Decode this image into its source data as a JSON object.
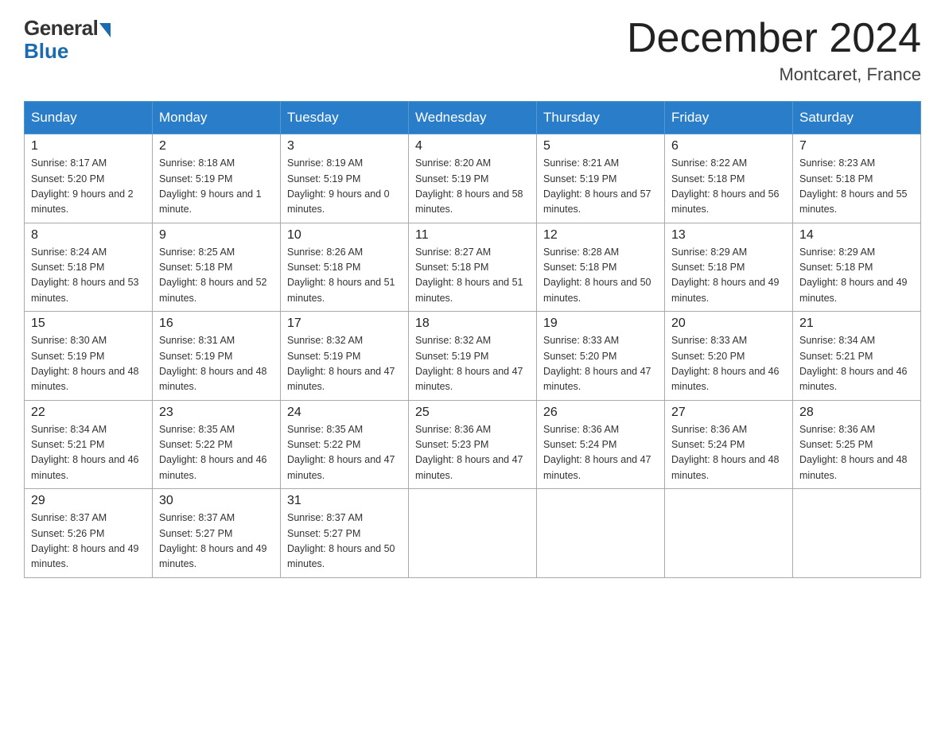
{
  "logo": {
    "general": "General",
    "blue": "Blue"
  },
  "header": {
    "month": "December 2024",
    "location": "Montcaret, France"
  },
  "weekdays": [
    "Sunday",
    "Monday",
    "Tuesday",
    "Wednesday",
    "Thursday",
    "Friday",
    "Saturday"
  ],
  "weeks": [
    [
      {
        "day": "1",
        "sunrise": "8:17 AM",
        "sunset": "5:20 PM",
        "daylight": "9 hours and 2 minutes."
      },
      {
        "day": "2",
        "sunrise": "8:18 AM",
        "sunset": "5:19 PM",
        "daylight": "9 hours and 1 minute."
      },
      {
        "day": "3",
        "sunrise": "8:19 AM",
        "sunset": "5:19 PM",
        "daylight": "9 hours and 0 minutes."
      },
      {
        "day": "4",
        "sunrise": "8:20 AM",
        "sunset": "5:19 PM",
        "daylight": "8 hours and 58 minutes."
      },
      {
        "day": "5",
        "sunrise": "8:21 AM",
        "sunset": "5:19 PM",
        "daylight": "8 hours and 57 minutes."
      },
      {
        "day": "6",
        "sunrise": "8:22 AM",
        "sunset": "5:18 PM",
        "daylight": "8 hours and 56 minutes."
      },
      {
        "day": "7",
        "sunrise": "8:23 AM",
        "sunset": "5:18 PM",
        "daylight": "8 hours and 55 minutes."
      }
    ],
    [
      {
        "day": "8",
        "sunrise": "8:24 AM",
        "sunset": "5:18 PM",
        "daylight": "8 hours and 53 minutes."
      },
      {
        "day": "9",
        "sunrise": "8:25 AM",
        "sunset": "5:18 PM",
        "daylight": "8 hours and 52 minutes."
      },
      {
        "day": "10",
        "sunrise": "8:26 AM",
        "sunset": "5:18 PM",
        "daylight": "8 hours and 51 minutes."
      },
      {
        "day": "11",
        "sunrise": "8:27 AM",
        "sunset": "5:18 PM",
        "daylight": "8 hours and 51 minutes."
      },
      {
        "day": "12",
        "sunrise": "8:28 AM",
        "sunset": "5:18 PM",
        "daylight": "8 hours and 50 minutes."
      },
      {
        "day": "13",
        "sunrise": "8:29 AM",
        "sunset": "5:18 PM",
        "daylight": "8 hours and 49 minutes."
      },
      {
        "day": "14",
        "sunrise": "8:29 AM",
        "sunset": "5:18 PM",
        "daylight": "8 hours and 49 minutes."
      }
    ],
    [
      {
        "day": "15",
        "sunrise": "8:30 AM",
        "sunset": "5:19 PM",
        "daylight": "8 hours and 48 minutes."
      },
      {
        "day": "16",
        "sunrise": "8:31 AM",
        "sunset": "5:19 PM",
        "daylight": "8 hours and 48 minutes."
      },
      {
        "day": "17",
        "sunrise": "8:32 AM",
        "sunset": "5:19 PM",
        "daylight": "8 hours and 47 minutes."
      },
      {
        "day": "18",
        "sunrise": "8:32 AM",
        "sunset": "5:19 PM",
        "daylight": "8 hours and 47 minutes."
      },
      {
        "day": "19",
        "sunrise": "8:33 AM",
        "sunset": "5:20 PM",
        "daylight": "8 hours and 47 minutes."
      },
      {
        "day": "20",
        "sunrise": "8:33 AM",
        "sunset": "5:20 PM",
        "daylight": "8 hours and 46 minutes."
      },
      {
        "day": "21",
        "sunrise": "8:34 AM",
        "sunset": "5:21 PM",
        "daylight": "8 hours and 46 minutes."
      }
    ],
    [
      {
        "day": "22",
        "sunrise": "8:34 AM",
        "sunset": "5:21 PM",
        "daylight": "8 hours and 46 minutes."
      },
      {
        "day": "23",
        "sunrise": "8:35 AM",
        "sunset": "5:22 PM",
        "daylight": "8 hours and 46 minutes."
      },
      {
        "day": "24",
        "sunrise": "8:35 AM",
        "sunset": "5:22 PM",
        "daylight": "8 hours and 47 minutes."
      },
      {
        "day": "25",
        "sunrise": "8:36 AM",
        "sunset": "5:23 PM",
        "daylight": "8 hours and 47 minutes."
      },
      {
        "day": "26",
        "sunrise": "8:36 AM",
        "sunset": "5:24 PM",
        "daylight": "8 hours and 47 minutes."
      },
      {
        "day": "27",
        "sunrise": "8:36 AM",
        "sunset": "5:24 PM",
        "daylight": "8 hours and 48 minutes."
      },
      {
        "day": "28",
        "sunrise": "8:36 AM",
        "sunset": "5:25 PM",
        "daylight": "8 hours and 48 minutes."
      }
    ],
    [
      {
        "day": "29",
        "sunrise": "8:37 AM",
        "sunset": "5:26 PM",
        "daylight": "8 hours and 49 minutes."
      },
      {
        "day": "30",
        "sunrise": "8:37 AM",
        "sunset": "5:27 PM",
        "daylight": "8 hours and 49 minutes."
      },
      {
        "day": "31",
        "sunrise": "8:37 AM",
        "sunset": "5:27 PM",
        "daylight": "8 hours and 50 minutes."
      },
      null,
      null,
      null,
      null
    ]
  ],
  "labels": {
    "sunrise": "Sunrise:",
    "sunset": "Sunset:",
    "daylight": "Daylight:"
  }
}
